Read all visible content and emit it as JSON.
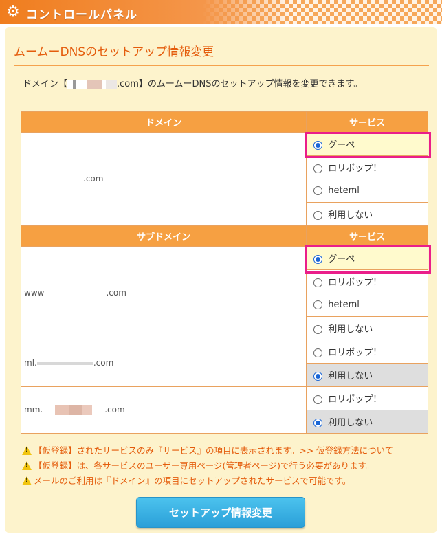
{
  "header": {
    "title": "コントロールパネル",
    "gear_glyph": "⚙"
  },
  "section": {
    "title": "ムームーDNSのセットアップ情報変更",
    "desc_prefix": "ドメイン【",
    "desc_domain_suffix": ".com",
    "desc_suffix": "】のムームーDNSのセットアップ情報を変更できます。"
  },
  "domain_table": {
    "header_domain": "ドメイン",
    "header_service": "サービス",
    "domain": ".com",
    "options": [
      {
        "label": "グーペ",
        "selected": true
      },
      {
        "label": "ロリポップ！",
        "selected": false
      },
      {
        "label": "heteml",
        "selected": false
      },
      {
        "label": "利用しない",
        "selected": false
      }
    ]
  },
  "subdomain_table": {
    "header_subdomain": "サブドメイン",
    "header_service": "サービス",
    "rows": [
      {
        "name_prefix": "www",
        "name_suffix": ".com",
        "options": [
          {
            "label": "グーペ",
            "selected": true
          },
          {
            "label": "ロリポップ！",
            "selected": false
          },
          {
            "label": "heteml",
            "selected": false
          },
          {
            "label": "利用しない",
            "selected": false
          }
        ]
      },
      {
        "name_prefix": "ml.",
        "name_suffix": ".com",
        "options": [
          {
            "label": "ロリポップ！",
            "selected": false
          },
          {
            "label": "利用しない",
            "selected": true
          }
        ]
      },
      {
        "name_prefix": "mm.",
        "name_suffix": ".com",
        "options": [
          {
            "label": "ロリポップ！",
            "selected": false
          },
          {
            "label": "利用しない",
            "selected": true
          }
        ]
      }
    ]
  },
  "notes": [
    {
      "text": "【仮登録】されたサービスのみ『サービス』の項目に表示されます。",
      "link": ">> 仮登録方法について"
    },
    {
      "text": "【仮登録】は、各サービスのユーザー専用ページ(管理者ページ)で行う必要があります。",
      "link": ""
    },
    {
      "text": "メールのご利用は『ドメイン』の項目にセットアップされたサービスで可能です。",
      "link": ""
    }
  ],
  "submit_label": "セットアップ情報変更",
  "colors": {
    "accent": "#e45c0c",
    "header_orange": "#f6a042",
    "highlight": "#ea1e8a",
    "button": "#2a9fd8"
  }
}
